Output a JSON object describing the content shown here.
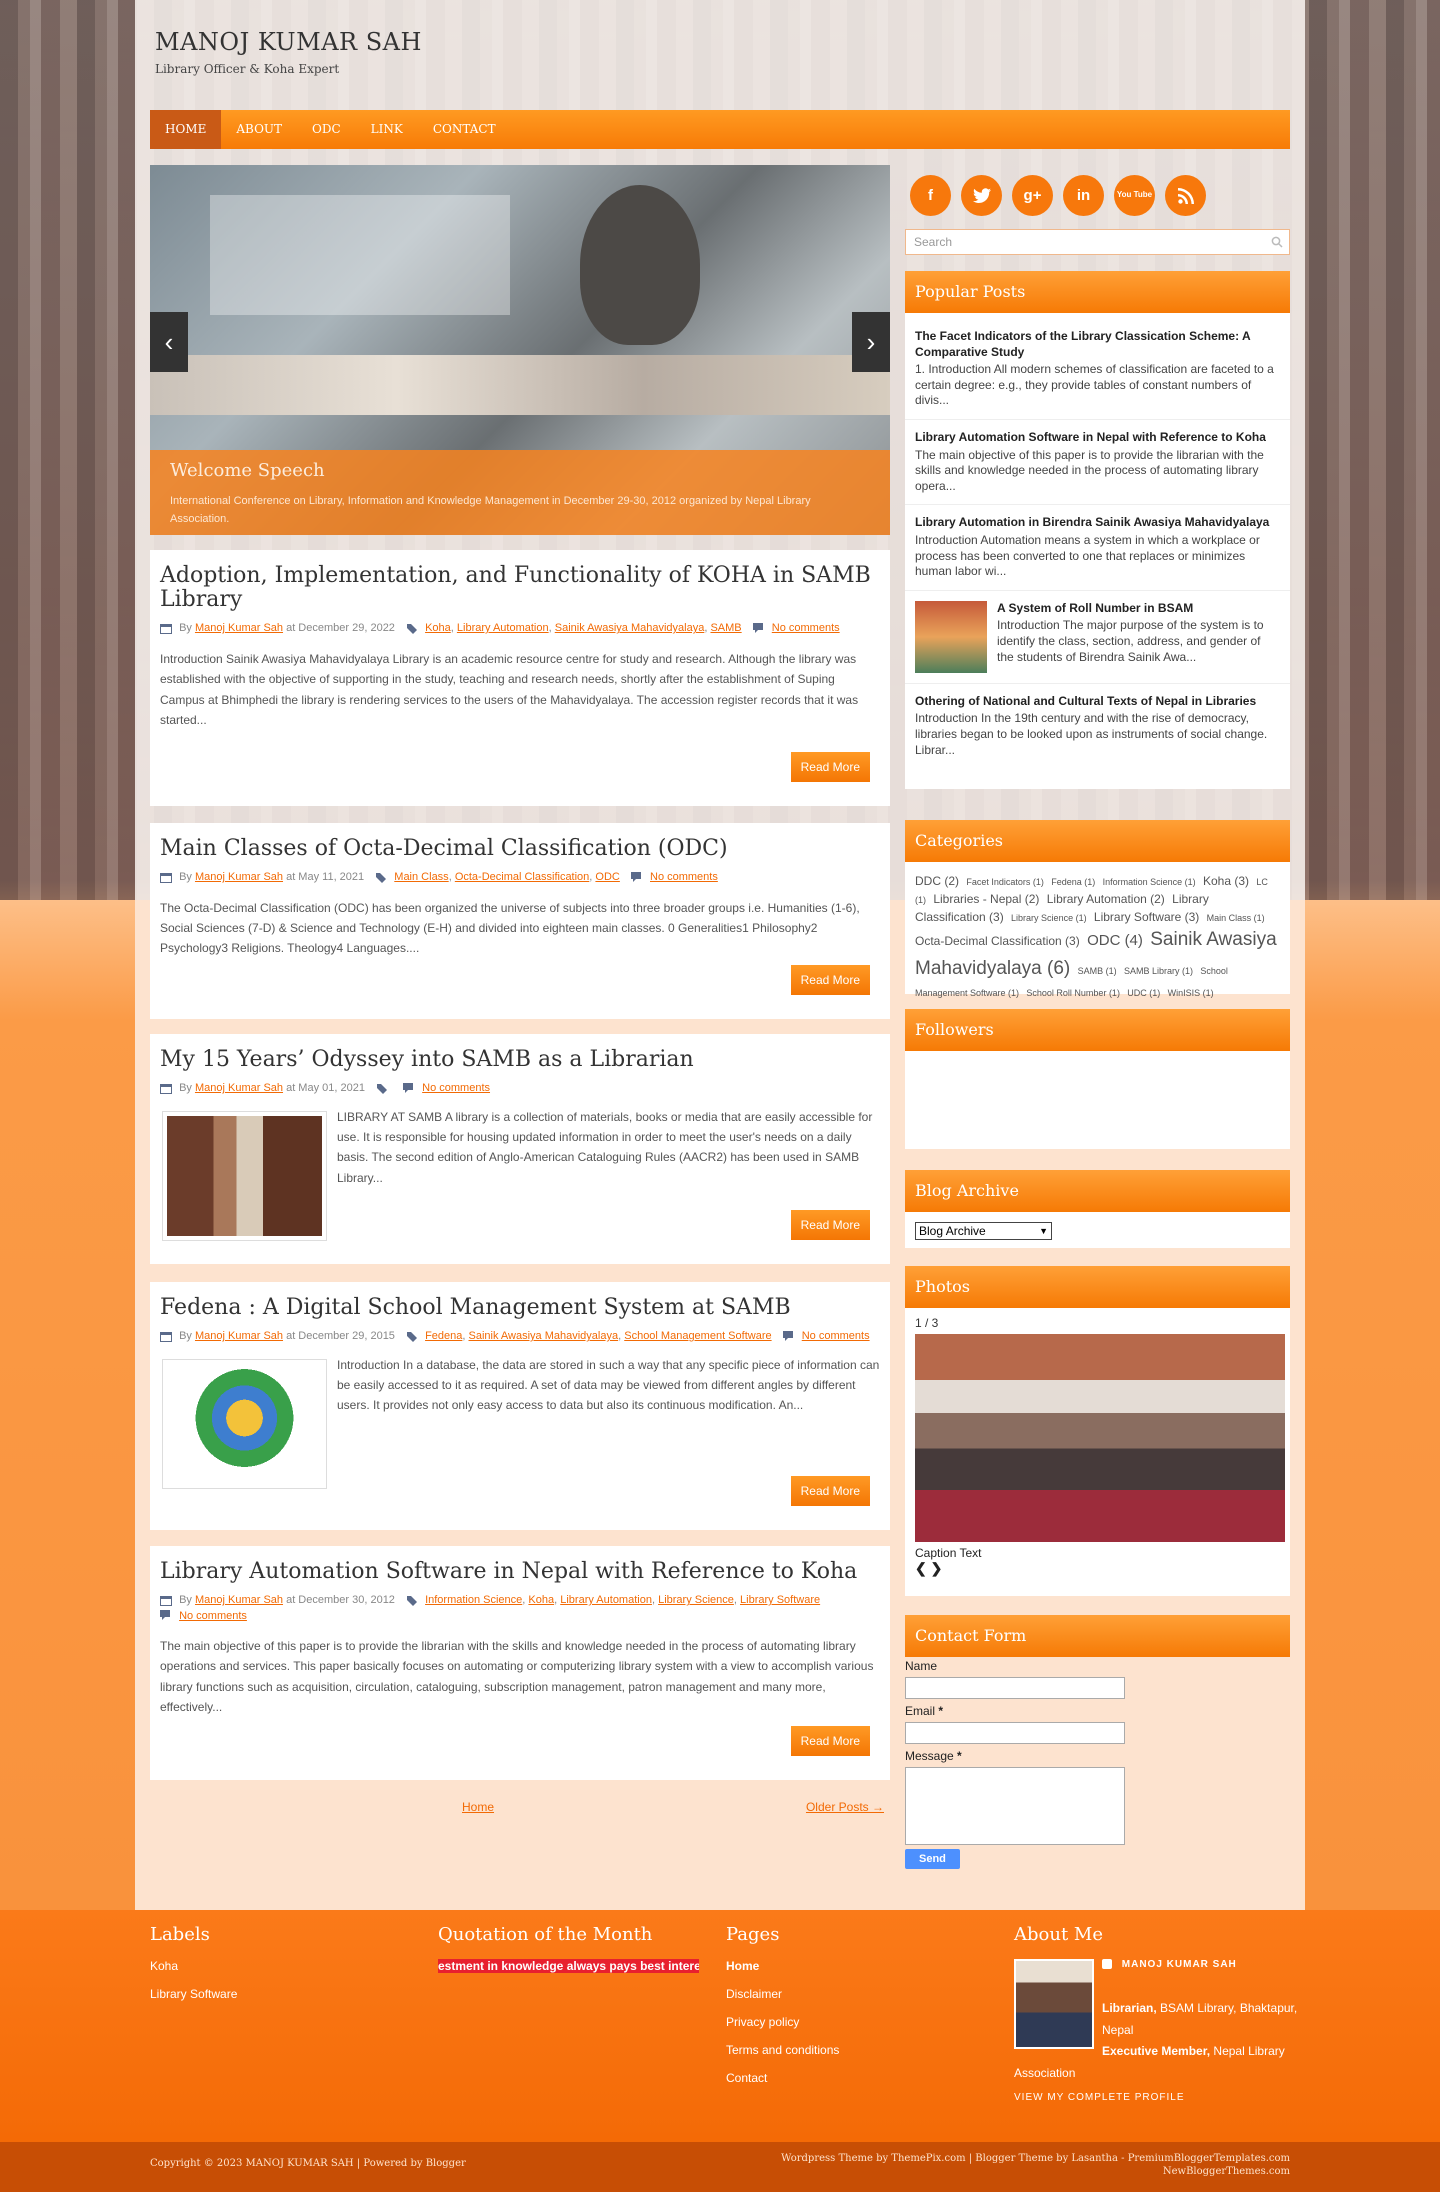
{
  "header": {
    "title": "MANOJ KUMAR SAH",
    "tagline": "Library Officer & Koha Expert"
  },
  "nav": [
    "HOME",
    "ABOUT",
    "ODC",
    "LINK",
    "CONTACT"
  ],
  "slider": {
    "title": "Welcome Speech",
    "caption": "International Conference on Library, Information and Knowledge Management in December 29-30, 2012 organized by Nepal Library Association.",
    "prev": "‹",
    "next": "›"
  },
  "posts": [
    {
      "title": "Adoption, Implementation, and Functionality of KOHA in SAMB Library",
      "by": "By",
      "author": "Manoj Kumar Sah",
      "date": "at December 29, 2022",
      "labels": [
        "Koha",
        "Library Automation",
        "Sainik Awasiya Mahavidyalaya",
        "SAMB"
      ],
      "comments": "No comments",
      "summary": " Introduction Sainik Awasiya Mahavidyalaya Library is an academic resource centre for study and research. Although the library was established with the objective of supporting in the study, teaching and research needs, shortly after the establishment of Suping Campus at Bhimphedi the library is rendering services to the users of the Mahavidyalaya. The accession register records that it was started..."
    },
    {
      "title": "Main Classes of Octa-Decimal Classification (ODC)",
      "by": "By",
      "author": "Manoj Kumar Sah",
      "date": "at May 11, 2021",
      "labels": [
        "Main Class",
        "Octa-Decimal Classification",
        "ODC"
      ],
      "comments": "No comments",
      "summary": "The Octa-Decimal Classification (ODC) has been organized the universe of subjects into three broader groups i.e. Humanities (1-6), Social Sciences (7-D) & Science and Technology (E-H) and divided into eighteen main classes. 0    Generalities1    Philosophy2    Psychology3    Religions. Theology4    Languages...."
    },
    {
      "title": "My 15 Years’ Odyssey into SAMB as a Librarian",
      "by": "By",
      "author": "Manoj Kumar Sah",
      "date": "at May 01, 2021",
      "labels": [],
      "comments": "No comments",
      "summary": "LIBRARY AT SAMB A library is a collection of materials, books or media that are easily accessible for use. It is responsible for housing updated information in order to meet the user's needs on a daily basis. The second edition of Anglo-American Cataloguing Rules (AACR2) has been used in SAMB Library..."
    },
    {
      "title": "Fedena : A Digital School Management System at SAMB",
      "by": "By",
      "author": "Manoj Kumar Sah",
      "date": "at December 29, 2015",
      "labels": [
        "Fedena",
        "Sainik Awasiya Mahavidyalaya",
        "School Management Software"
      ],
      "comments": "No comments",
      "summary": "Introduction In a database, the data are stored in such a way that any specific piece of information can be easily accessed to it as required. A set of data may be viewed from different angles by different users. It provides not only easy access to data but also its continuous modification. An..."
    },
    {
      "title": "Library Automation Software in Nepal with Reference to Koha",
      "by": "By",
      "author": "Manoj Kumar Sah",
      "date": "at December 30, 2012",
      "labels": [
        "Information Science",
        "Koha",
        "Library Automation",
        "Library Science",
        "Library Software"
      ],
      "comments": "No comments",
      "summary": "The main objective of this paper is to provide the librarian with the skills and knowledge needed in the process of automating library operations and services. This paper basically focuses on automating or computerizing library system with a view to accomplish various library functions such as acquisition, circulation, cataloguing, subscription management, patron management and many more, effectively..."
    }
  ],
  "read_more": "Read More",
  "pager": {
    "home": "Home",
    "older": "Older Posts →"
  },
  "social": [
    "f",
    "t",
    "g+",
    "in",
    "You Tube",
    "rss"
  ],
  "search": {
    "placeholder": "Search"
  },
  "popular": {
    "title": "Popular Posts",
    "items": [
      {
        "title": "The Facet Indicators of the Library Classication Scheme: A Comparative Study",
        "snippet": "1. Introduction All modern schemes of classification are faceted to a certain degree: e.g., they provide tables of constant numbers of divis..."
      },
      {
        "title": "Library Automation Software in Nepal with Reference to Koha",
        "snippet": "The main objective of this paper is to provide the librarian with the skills and knowledge needed in the process of automating library opera..."
      },
      {
        "title": "Library Automation in Birendra Sainik Awasiya Mahavidyalaya",
        "snippet": "Introduction   Automation means a system in which a workplace or process has been converted to one that replaces or minimizes human labor wi..."
      },
      {
        "title": "A System of Roll Number in BSAM",
        "snippet": "Introduction   The major purpose of the system is to identify the class, section, address, and gender of the students of Birendra Sainik Awa..."
      },
      {
        "title": "Othering of National and Cultural Texts of Nepal in Libraries",
        "snippet": "Introduction   In the 19th century and with the rise of democracy, libraries began to be looked upon as instruments of social change. Librar..."
      }
    ]
  },
  "categories": {
    "title": "Categories",
    "items": [
      {
        "name": "DDC",
        "count": "(2)",
        "size": 12
      },
      {
        "name": "Facet Indicators",
        "count": "(1)",
        "size": 9
      },
      {
        "name": "Fedena",
        "count": "(1)",
        "size": 9
      },
      {
        "name": "Information Science",
        "count": "(1)",
        "size": 9
      },
      {
        "name": "Koha",
        "count": "(3)",
        "size": 12
      },
      {
        "name": "LC",
        "count": "(1)",
        "size": 9
      },
      {
        "name": "Libraries - Nepal",
        "count": "(2)",
        "size": 12
      },
      {
        "name": "Library Automation",
        "count": "(2)",
        "size": 12
      },
      {
        "name": "Library Classification",
        "count": "(3)",
        "size": 12
      },
      {
        "name": "Library Science",
        "count": "(1)",
        "size": 9
      },
      {
        "name": "Library Software",
        "count": "(3)",
        "size": 12
      },
      {
        "name": "Main Class",
        "count": "(1)",
        "size": 9
      },
      {
        "name": "Octa-Decimal Classification",
        "count": "(3)",
        "size": 12
      },
      {
        "name": "ODC",
        "count": "(4)",
        "size": 15
      },
      {
        "name": "Sainik Awasiya Mahavidyalaya",
        "count": "(6)",
        "size": 19
      },
      {
        "name": "SAMB",
        "count": "(1)",
        "size": 9
      },
      {
        "name": "SAMB Library",
        "count": "(1)",
        "size": 9
      },
      {
        "name": "School Management Software",
        "count": "(1)",
        "size": 9
      },
      {
        "name": "School Roll Number",
        "count": "(1)",
        "size": 9
      },
      {
        "name": "UDC",
        "count": "(1)",
        "size": 9
      },
      {
        "name": "WinISIS",
        "count": "(1)",
        "size": 9
      }
    ]
  },
  "followers": {
    "title": "Followers"
  },
  "archive": {
    "title": "Blog Archive",
    "select": "Blog Archive"
  },
  "photos": {
    "title": "Photos",
    "counter": "1 / 3",
    "caption": "Caption Text",
    "nav": "❮ ❯"
  },
  "contact": {
    "title": "Contact Form",
    "name": "Name",
    "email": "Email",
    "message": "Message",
    "required": "*",
    "send": "Send"
  },
  "footer": {
    "labels": {
      "title": "Labels",
      "items": [
        "Koha",
        "Library Software"
      ]
    },
    "quote": {
      "title": "Quotation of the Month",
      "text": "estment in knowledge always pays best intere"
    },
    "pages": {
      "title": "Pages",
      "items": [
        "Home",
        "Disclaimer",
        "Privacy policy",
        "Terms and conditions",
        "Contact"
      ]
    },
    "about": {
      "title": "About Me",
      "name": "MANOJ KUMAR SAH",
      "role1": "Librarian,",
      "role1b": "BSAM Library, Bhaktapur, Nepal",
      "role2": "Executive Member,",
      "role2b": "Nepal Library Association",
      "profile": "VIEW MY COMPLETE PROFILE"
    }
  },
  "bottom": {
    "left": "Copyright © 2023 MANOJ KUMAR SAH | Powered by Blogger",
    "right1": "Wordpress Theme by ThemePix.com | Blogger Theme by Lasantha - PremiumBloggerTemplates.com",
    "right2": "NewBloggerThemes.com"
  },
  "colors": {
    "accent": "#f7780c",
    "nav_active": "#c95a16",
    "link": "#f26a05"
  }
}
